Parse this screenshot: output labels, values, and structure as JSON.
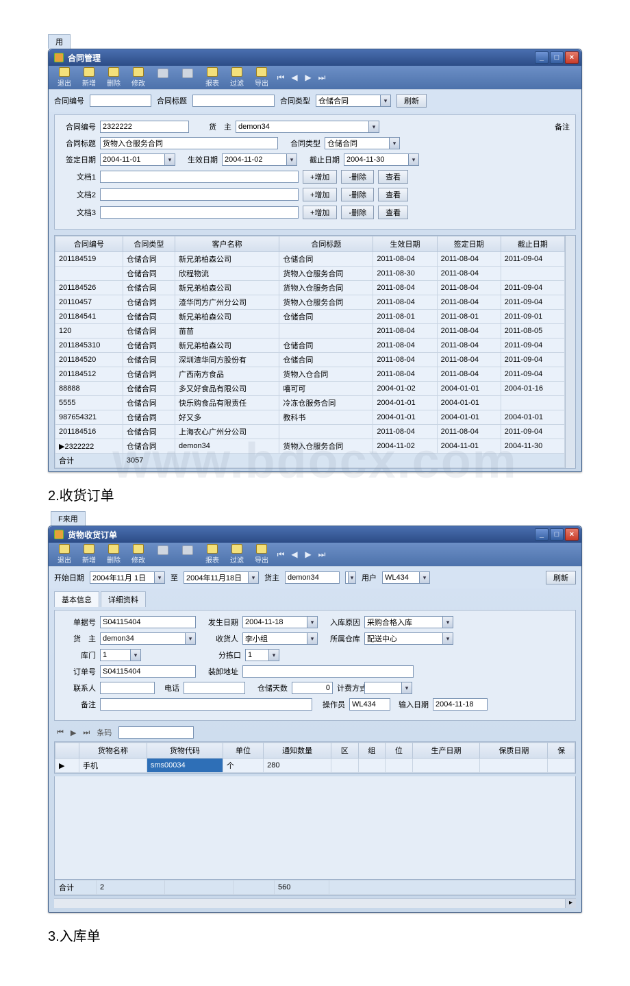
{
  "window1": {
    "title": "合同管理",
    "toolbar": [
      "退出",
      "新增",
      "删除",
      "修改",
      "",
      "",
      "报表",
      "过滤",
      "导出"
    ],
    "topfilter": {
      "l1": "合同编号",
      "l2": "合同标题",
      "l3": "合同类型",
      "v3": "仓储合同",
      "refresh": "刷新"
    },
    "form": {
      "contract_no_l": "合同编号",
      "contract_no": "2322222",
      "owner_l": "货　主",
      "owner": "demon34",
      "remark_l": "备注",
      "title_l": "合同标题",
      "title": "货物入仓服务合同",
      "type_l": "合同类型",
      "type": "仓储合同",
      "sign_l": "签定日期",
      "sign": "2004-11-01",
      "start_l": "生效日期",
      "start": "2004-11-02",
      "end_l": "截止日期",
      "end": "2004-11-30",
      "doc1_l": "文档1",
      "doc2_l": "文档2",
      "doc3_l": "文档3",
      "add": "+增加",
      "del": "-删除",
      "view": "查看"
    },
    "grid_headers": [
      "合同编号",
      "合同类型",
      "客户名称",
      "合同标题",
      "生效日期",
      "签定日期",
      "截止日期"
    ],
    "grid_rows": [
      [
        "201184519",
        "仓储合同",
        "新兄弟柏森公司",
        "仓储合同",
        "2011-08-04",
        "2011-08-04",
        "2011-09-04"
      ],
      [
        "",
        "仓储合同",
        "欣程物流",
        "货物入仓服务合同",
        "2011-08-30",
        "2011-08-04",
        ""
      ],
      [
        "201184526",
        "仓储合同",
        "新兄弟柏森公司",
        "货物入仓服务合同",
        "2011-08-04",
        "2011-08-04",
        "2011-09-04"
      ],
      [
        "20110457",
        "仓储合同",
        "渣华同方广州分公司",
        "货物入仓服务合同",
        "2011-08-04",
        "2011-08-04",
        "2011-09-04"
      ],
      [
        "201184541",
        "仓储合同",
        "新兄弟柏森公司",
        "仓储合同",
        "2011-08-01",
        "2011-08-01",
        "2011-09-01"
      ],
      [
        "120",
        "仓储合同",
        "苗苗",
        "",
        "2011-08-04",
        "2011-08-04",
        "2011-08-05"
      ],
      [
        "2011845310",
        "仓储合同",
        "新兄弟柏森公司",
        "仓储合同",
        "2011-08-04",
        "2011-08-04",
        "2011-09-04"
      ],
      [
        "201184520",
        "仓储合同",
        "深圳渣华同方股份有",
        "仓储合同",
        "2011-08-04",
        "2011-08-04",
        "2011-09-04"
      ],
      [
        "201184512",
        "仓储合同",
        "广西南方食品",
        "货物入仓合同",
        "2011-08-04",
        "2011-08-04",
        "2011-09-04"
      ],
      [
        "88888",
        "仓储合同",
        "多又好食品有限公司",
        "嘻可可",
        "2004-01-02",
        "2004-01-01",
        "2004-01-16"
      ],
      [
        "5555",
        "仓储合同",
        "快乐购食品有限责任",
        "冷冻仓服务合同",
        "2004-01-01",
        "2004-01-01",
        ""
      ],
      [
        "987654321",
        "仓储合同",
        "好又多",
        "教科书",
        "2004-01-01",
        "2004-01-01",
        "2004-01-01"
      ],
      [
        "201184516",
        "仓储合同",
        "上海农心广州分公司",
        "",
        "2011-08-04",
        "2011-08-04",
        "2011-09-04"
      ],
      [
        "2322222",
        "仓储合同",
        "demon34",
        "货物入仓服务合同",
        "2004-11-02",
        "2004-11-01",
        "2004-11-30"
      ]
    ],
    "footer": {
      "label": "合计",
      "count": "3057"
    }
  },
  "section2_title": "2.收货订单",
  "apptab": "F来用",
  "window2": {
    "title": "货物收货订单",
    "toolbar": [
      "退出",
      "新增",
      "删除",
      "修改",
      "",
      "",
      "报表",
      "过滤",
      "导出"
    ],
    "topfilter": {
      "start_l": "开始日期",
      "start": "2004年11月 1日",
      "to": "至",
      "end": "2004年11月18日",
      "owner_l": "货主",
      "owner": "demon34",
      "user_l": "用户",
      "user": "WL434",
      "refresh": "刷新"
    },
    "tabs": [
      "基本信息",
      "详细资料"
    ],
    "form": {
      "billno_l": "单据号",
      "billno": "S04115404",
      "date_l": "发生日期",
      "date": "2004-11-18",
      "reason_l": "入库原因",
      "reason": "采购合格入库",
      "owner_l": "货　主",
      "owner": "demon34",
      "recv_l": "收货人",
      "recv": "李小组",
      "dept_l": "所属仓库",
      "dept": "配送中心",
      "gate_l": "库门",
      "gate": "1",
      "dock_l": "分拣口",
      "dock": "1",
      "order_l": "订单号",
      "order": "S04115404",
      "addr_l": "装卸地址",
      "contact_l": "联系人",
      "phone_l": "电话",
      "days_l": "仓储天数",
      "days": "0",
      "feetype_l": "计费方式",
      "note_l": "备注",
      "oper_l": "操作员",
      "oper": "WL434",
      "inputdate_l": "输入日期",
      "inputdate": "2004-11-18"
    },
    "navrow": {
      "barcode_l": "条码"
    },
    "grid_headers": [
      "",
      "货物名称",
      "货物代码",
      "单位",
      "通知数量",
      "区",
      "组",
      "位",
      "生产日期",
      "保质日期",
      "保"
    ],
    "grid_rows": [
      [
        "▶",
        "手机",
        "sms00034",
        "个",
        "280",
        "",
        "",
        "",
        "",
        "",
        ""
      ]
    ],
    "footer": {
      "label": "合计",
      "count": "2",
      "qty": "560"
    }
  },
  "section3_title": "3.入库单"
}
